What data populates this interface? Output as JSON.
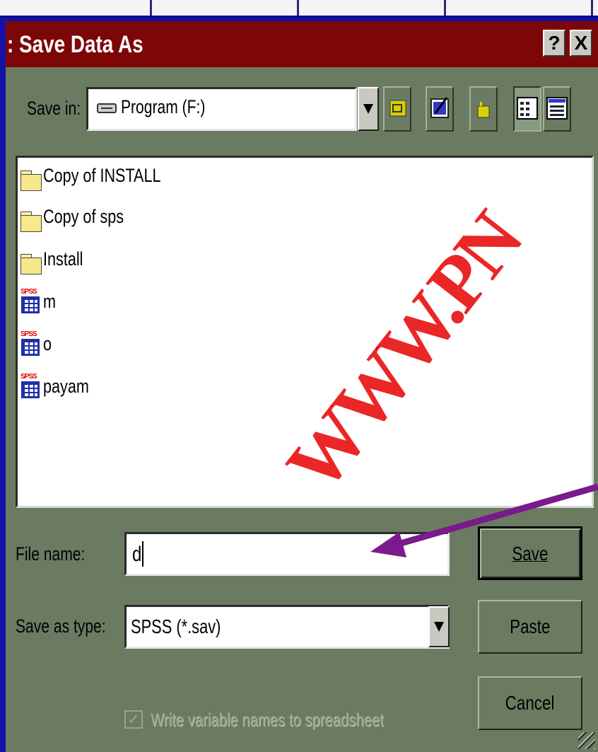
{
  "dialog": {
    "title": ": Save Data As",
    "help_button": "?",
    "close_button": "X"
  },
  "save_in": {
    "label": "Save in:",
    "value": "Program (F:)"
  },
  "files": [
    {
      "name": "Copy of INSTALL",
      "type": "folder"
    },
    {
      "name": "Copy of sps",
      "type": "folder"
    },
    {
      "name": "Install",
      "type": "folder"
    },
    {
      "name": "m",
      "type": "spss"
    },
    {
      "name": "o",
      "type": "spss"
    },
    {
      "name": "payam",
      "type": "spss"
    }
  ],
  "spss_icon_text": "SPSS",
  "file_name": {
    "label": "File name:",
    "value": "d"
  },
  "save_type": {
    "label": "Save as type:",
    "value": "SPSS (*.sav)"
  },
  "buttons": {
    "save": "Save",
    "paste": "Paste",
    "cancel": "Cancel"
  },
  "checkbox": {
    "label": "Write variable names to spreadsheet",
    "checked": true,
    "enabled": false
  },
  "watermark": "WWW.PN",
  "colors": {
    "desktop": "#1212a6",
    "titlebar": "#7d0607",
    "dialog_face": "#6b7b62",
    "annotation_arrow": "#7a1a8c",
    "watermark": "#e60000"
  }
}
